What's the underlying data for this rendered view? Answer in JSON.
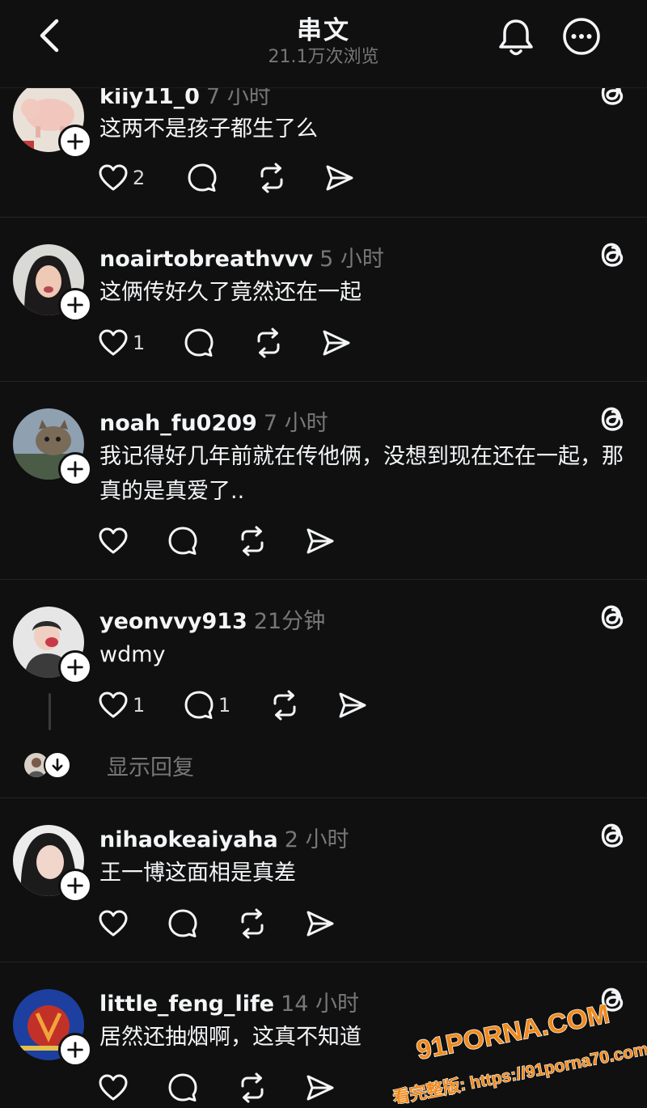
{
  "header": {
    "title": "串文",
    "views": "21.1万次浏览"
  },
  "posts": [
    {
      "username": "kiiy11_0",
      "time": "7 小时",
      "text": "这两不是孩子都生了么",
      "likes": "2",
      "replies": ""
    },
    {
      "username": "noairtobreathvvv",
      "time": "5 小时",
      "text": "这俩传好久了竟然还在一起",
      "likes": "1",
      "replies": ""
    },
    {
      "username": "noah_fu0209",
      "time": "7 小时",
      "text": "我记得好几年前就在传他俩，没想到现在还在一起，那真的是真爱了..",
      "likes": "",
      "replies": ""
    },
    {
      "username": "yeonvvy913",
      "time": "21分钟",
      "text": "wdmy",
      "likes": "1",
      "replies": "1"
    },
    {
      "username": "nihaokeaiyaha",
      "time": "2 小时",
      "text": "王一博这面相是真差",
      "likes": "",
      "replies": ""
    },
    {
      "username": "little_feng_life",
      "time": "14 小时",
      "text": "居然还抽烟啊，这真不知道",
      "likes": "",
      "replies": ""
    }
  ],
  "show_replies": "显示回复",
  "watermark": {
    "brand": "91PORNA.COM",
    "line2": "看完整版: https://91porna70.com"
  },
  "icons": {
    "back": "chevron-left-icon",
    "bell": "bell-icon",
    "more": "more-icon",
    "like": "heart-icon",
    "reply": "comment-icon",
    "repost": "repost-icon",
    "share": "send-icon",
    "threads": "threads-icon"
  },
  "colors": {
    "background": "#101010",
    "text": "#f3f5f7",
    "muted": "#777777",
    "watermark_orange": "#f08a1c"
  }
}
